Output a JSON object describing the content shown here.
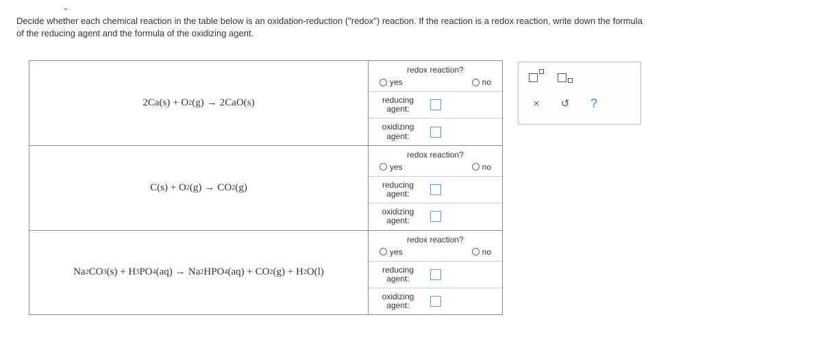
{
  "prompt_line1": "Decide whether each chemical reaction in the table below is an oxidation-reduction (\"redox\") reaction. If the reaction is a redox reaction, write down the formula",
  "prompt_line2": "of the reducing agent and the formula of the oxidizing agent.",
  "header_redox": "redox reaction?",
  "yes": "yes",
  "no": "no",
  "reducing_label": "reducing agent:",
  "oxidizing_label": "oxidizing agent:",
  "reactions": {
    "r1": "2Ca(s) + O₂(g) → 2CaO(s)",
    "r2": "C(s) + O₂(g) → CO₂(g)",
    "r3": "Na₂CO₃(s) + H₃PO₄(aq) → Na₂HPO₄(aq) + CO₂(g) + H₂O(l)"
  },
  "toolbar": {
    "clear": "×",
    "reset": "↺",
    "help": "?"
  }
}
